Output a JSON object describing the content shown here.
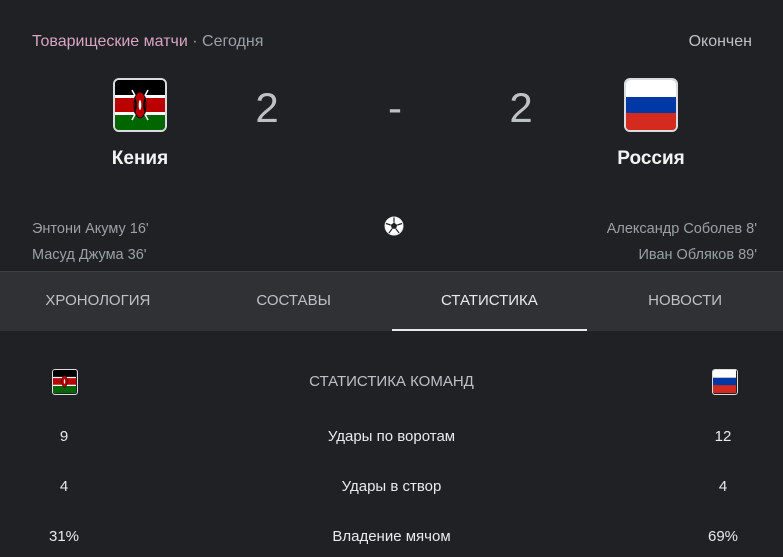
{
  "match": {
    "league": "Товарищеские матчи",
    "separator": "·",
    "day": "Сегодня",
    "status": "Окончен",
    "dash": "-",
    "home": {
      "name": "Кения",
      "score": "2",
      "scorers": [
        "Энтони Акуму 16'",
        "Масуд Джума 36'"
      ],
      "flag": "kenya-flag"
    },
    "away": {
      "name": "Россия",
      "score": "2",
      "scorers": [
        "Александр Соболев 8'",
        "Иван Обляков 89'"
      ],
      "flag": "russia-flag"
    },
    "goal_icon": "soccer-ball-icon"
  },
  "tabs": [
    {
      "label": "ХРОНОЛОГИЯ",
      "active": false
    },
    {
      "label": "СОСТАВЫ",
      "active": false
    },
    {
      "label": "СТАТИСТИКА",
      "active": true
    },
    {
      "label": "НОВОСТИ",
      "active": false
    }
  ],
  "stats": {
    "title": "СТАТИСТИКА КОМАНД",
    "rows": [
      {
        "label": "Удары по воротам",
        "home": "9",
        "away": "12"
      },
      {
        "label": "Удары в створ",
        "home": "4",
        "away": "4"
      },
      {
        "label": "Владение мячом",
        "home": "31%",
        "away": "69%"
      }
    ]
  },
  "colors": {
    "background": "#202124",
    "tabs_background": "#303134",
    "league_text": "#d7a4c2",
    "kenya_black": "#000000",
    "kenya_red": "#bb0000",
    "kenya_green": "#006600",
    "russia_white": "#ffffff",
    "russia_blue": "#0039a6",
    "russia_red": "#d52b1e"
  }
}
